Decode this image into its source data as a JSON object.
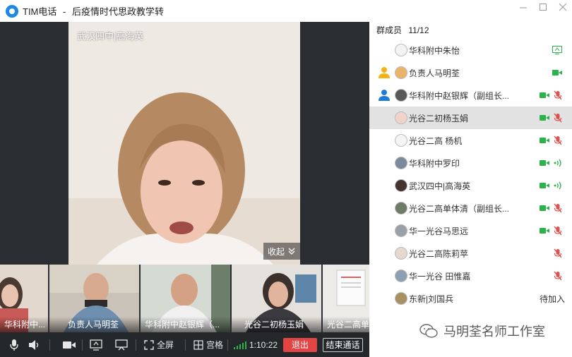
{
  "window": {
    "app_name": "TIM电话",
    "separator": "-",
    "title": "后疫情时代思政教学转"
  },
  "speaker": {
    "name": "武汉四中|高海英",
    "collapse_label": "收起"
  },
  "thumbnails": [
    {
      "label": "华科附中..."
    },
    {
      "label": "负责人马明荃"
    },
    {
      "label": "华科附中赵银辉（..."
    },
    {
      "label": "光谷二初杨玉娟"
    },
    {
      "label": "光谷二高单"
    }
  ],
  "toolbar": {
    "fullscreen_label": "全屏",
    "grid_label": "宫格",
    "duration": "1:10:22",
    "exit_label": "退出",
    "end_call_label": "结束通话"
  },
  "members": {
    "header_label": "群成员",
    "count": "11/12",
    "list": [
      {
        "name": "华科附中朱怡",
        "role": "",
        "status": "screen-share"
      },
      {
        "name": "负责人马明荃",
        "role": "owner",
        "status": "video"
      },
      {
        "name": "华科附中赵银辉（副组长...",
        "role": "admin",
        "status": "video-muted"
      },
      {
        "name": "光谷二初杨玉娟",
        "role": "",
        "status": "video-muted"
      },
      {
        "name": "光谷二高 杨机",
        "role": "",
        "status": "video-muted"
      },
      {
        "name": "华科附中罗印",
        "role": "",
        "status": "video-speaking"
      },
      {
        "name": "武汉四中|高海英",
        "role": "",
        "status": "video-speaking"
      },
      {
        "name": "光谷二高单体清（副组长...",
        "role": "",
        "status": "video-muted"
      },
      {
        "name": "华一光谷马思远",
        "role": "",
        "status": "video-muted"
      },
      {
        "name": "光谷二高陈莉苹",
        "role": "",
        "status": "muted"
      },
      {
        "name": "华一光谷 田惟嘉",
        "role": "",
        "status": "muted"
      },
      {
        "name": "东新|刘国兵",
        "role": "",
        "status": "pending",
        "status_text": "待加入"
      }
    ]
  },
  "watermark": {
    "text": "马明荃名师工作室",
    "icon": "wechat-icon"
  },
  "colors": {
    "accent_green": "#2bb34a",
    "muted_red": "#e0504e",
    "exit_red": "#e24343",
    "role_blue": "#1e7bd8",
    "role_gold": "#f3b316"
  }
}
